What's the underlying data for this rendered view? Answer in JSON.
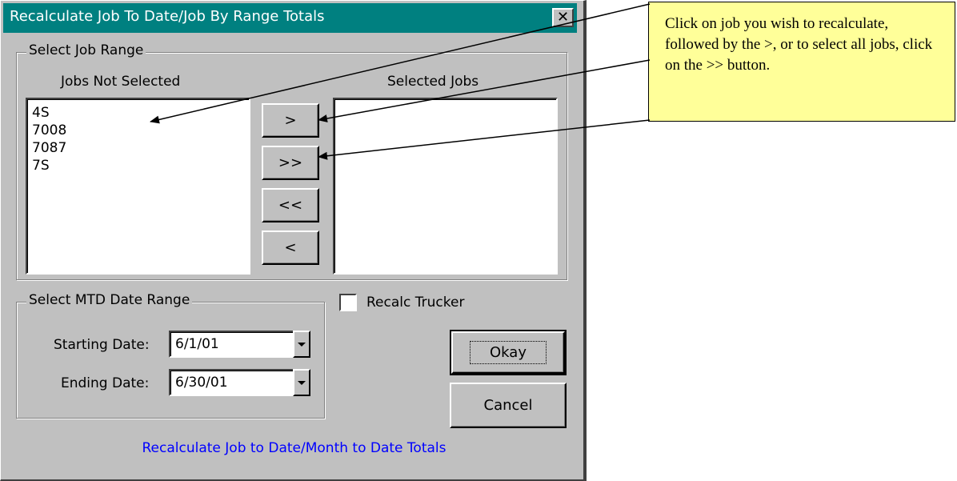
{
  "window": {
    "title": "Recalculate Job To Date/Job By Range Totals",
    "close_label": "✕"
  },
  "job_range": {
    "group_label": "Select Job Range",
    "not_selected_label": "Jobs Not Selected",
    "selected_label": "Selected Jobs",
    "not_selected_items": [
      "4S",
      "7008",
      "7087",
      "7S"
    ],
    "selected_items": [],
    "buttons": {
      "add_one": ">",
      "add_all": ">>",
      "remove_all": "<<",
      "remove_one": "<"
    }
  },
  "date_range": {
    "group_label": "Select MTD Date Range",
    "starting_label": "Starting Date:",
    "starting_value": "6/1/01",
    "ending_label": "Ending Date:",
    "ending_value": "6/30/01"
  },
  "recalc_trucker": {
    "label": "Recalc Trucker",
    "checked": false
  },
  "actions": {
    "okay": "Okay",
    "cancel": "Cancel"
  },
  "footer": "Recalculate Job to Date/Month to Date Totals",
  "callout": {
    "text": "Click on job you wish to recalculate, followed by the >, or to select all jobs, click on the >> button."
  },
  "colors": {
    "titlebar": "#008080",
    "dialog": "#c0c0c0",
    "footer_text": "#0000ff",
    "callout_bg": "#ffff99"
  }
}
